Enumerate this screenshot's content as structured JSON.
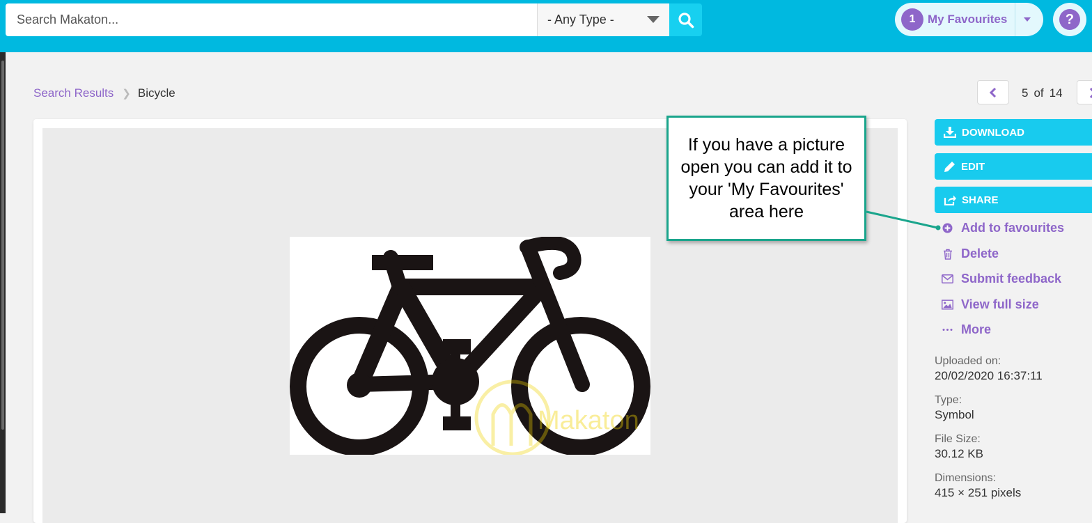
{
  "search": {
    "placeholder": "Search Makaton...",
    "type_value": "- Any Type -"
  },
  "favourites": {
    "count": "1",
    "label": "My Favourites"
  },
  "help": {
    "label": "?"
  },
  "breadcrumb": {
    "parent": "Search Results",
    "current": "Bicycle"
  },
  "pager": {
    "current": "5",
    "of": "of",
    "total": "14"
  },
  "actions": {
    "download": "DOWNLOAD",
    "edit": "EDIT",
    "share": "SHARE",
    "add_favourites": "Add to favourites",
    "delete": "Delete",
    "feedback": "Submit feedback",
    "full_size": "View full size",
    "more": "More"
  },
  "meta": {
    "uploaded_label": "Uploaded on:",
    "uploaded_value": "20/02/2020 16:37:11",
    "type_label": "Type:",
    "type_value": "Symbol",
    "size_label": "File Size:",
    "size_value": "30.12 KB",
    "dim_label": "Dimensions:",
    "dim_value": "415 × 251 pixels"
  },
  "watermark": "Makaton",
  "callout": "If you have a picture open you can add it to your 'My Favourites' area here",
  "colors": {
    "header": "#00b9e0",
    "accent": "#8e66c9",
    "button": "#18cbee",
    "callout_border": "#1aa58c"
  }
}
